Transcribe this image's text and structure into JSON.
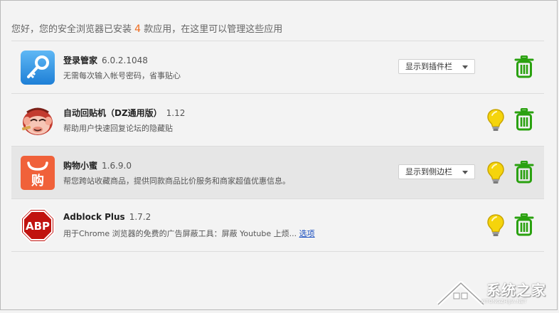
{
  "summary": {
    "prefix": "您好，您的安全浏览器已安装",
    "count": "4",
    "suffix": "款应用，在这里可以管理这些应用"
  },
  "apps": [
    {
      "name": "登录管家",
      "version": "6.0.2.1048",
      "description": "无需每次输入帐号密码，省事贴心",
      "dropdown": "显示到插件栏",
      "icon": "key-icon",
      "has_bulb": false
    },
    {
      "name": "自动回贴机（DZ通用版）",
      "version": "1.12",
      "description": "帮助用户快速回复论坛的隐藏贴",
      "dropdown": "",
      "icon": "monkey-icon",
      "has_bulb": true
    },
    {
      "name": "购物小蜜",
      "version": "1.6.9.0",
      "description": "帮您跨站收藏商品，提供同款商品比价服务和商家超值优惠信息。",
      "dropdown": "显示到侧边栏",
      "icon": "shopping-bag-icon",
      "icon_text": "购",
      "has_bulb": true
    },
    {
      "name": "Adblock Plus",
      "version": "1.7.2",
      "description": "用于Chrome 浏览器的免费的广告屏蔽工具：屏蔽 Youtube 上烦...",
      "options_link": "选项",
      "icon": "abp-stop-sign-icon",
      "icon_text": "ABP",
      "has_bulb": true
    }
  ],
  "watermark": {
    "text": "系统之家",
    "sub": "XITONGZHIJIA.NET"
  },
  "colors": {
    "accent_count": "#ee6b1e",
    "trash_green": "#2aa10f",
    "bulb_yellow": "#f5d40c",
    "link_blue": "#1a4fbf"
  }
}
